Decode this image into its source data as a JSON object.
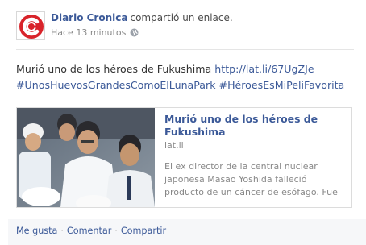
{
  "post": {
    "author": "Diario Cronica",
    "action": "compartió un enlace.",
    "timestamp": "Hace 13 minutos",
    "privacy_icon": "globe-icon",
    "message": {
      "text": "Murió uno de los héroes de Fukushima",
      "link": "http://lat.li/67UgZJe",
      "hashtags": [
        "#UnosHuevosGrandesComoElLunaPark",
        "#HéroesEsMiPeliFavorita"
      ]
    },
    "card": {
      "title": "Murió uno de los héroes de Fukushima",
      "domain": "lat.li",
      "description": "El ex director de la central nuclear japonesa Masao Yoshida falleció producto de un cáncer de esófago. Fue"
    },
    "footer": {
      "like": "Me gusta",
      "comment": "Comentar",
      "share": "Compartir",
      "separator": "·"
    }
  },
  "colors": {
    "link": "#3b5998",
    "logo_red": "#d8232a",
    "footer_bg": "#f6f7f9"
  }
}
